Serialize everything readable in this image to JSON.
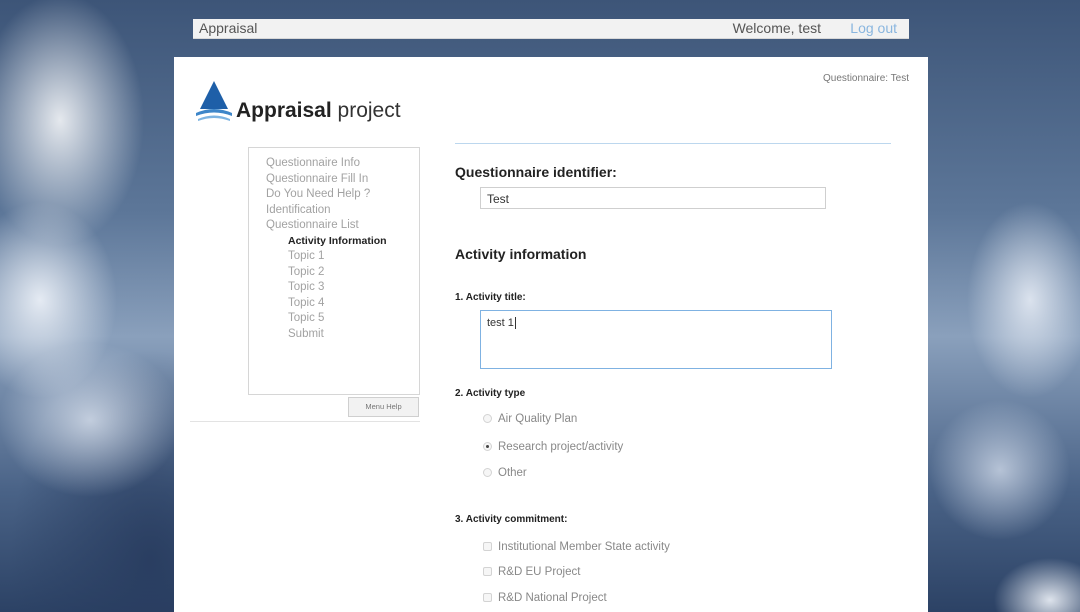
{
  "topbar": {
    "app_name": "Appraisal",
    "welcome": "Welcome, test",
    "logout": "Log out"
  },
  "header": {
    "questionnaire_label": "Questionnaire: Test",
    "brand_bold": "Appraisal",
    "brand_rest": " project",
    "logo_icon": "appraisal-logo-icon",
    "logo_color": "#1e5fa8"
  },
  "menu": {
    "items": [
      "Questionnaire Info",
      "Questionnaire Fill In",
      "Do You Need Help ?",
      "Identification",
      "Questionnaire List"
    ],
    "sub_items": [
      "Activity Information",
      "Topic 1",
      "Topic 2",
      "Topic 3",
      "Topic 4",
      "Topic 5",
      "Submit"
    ],
    "active": "Activity Information",
    "help_button": "Menu Help"
  },
  "form": {
    "identifier_heading": "Questionnaire identifier:",
    "identifier_value": "Test",
    "section_heading": "Activity information",
    "title_label": "1. Activity title:",
    "title_value": "test 1",
    "type_label": "2. Activity type",
    "type_options": [
      "Air Quality Plan",
      "Research project/activity",
      "Other"
    ],
    "type_selected": "Research project/activity",
    "commitment_label": "3. Activity commitment:",
    "commitment_options": [
      "Institutional Member State activity",
      "R&D EU Project",
      "R&D National Project"
    ]
  },
  "colors": {
    "accent": "#7fb2e2",
    "logout_link": "#8ab6df"
  }
}
